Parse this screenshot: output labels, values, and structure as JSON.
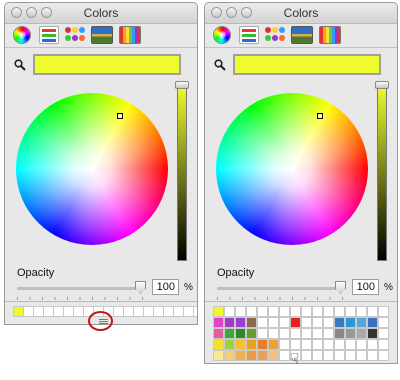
{
  "windows": [
    {
      "title": "Colors",
      "current_color": "#eefc2f",
      "opacity_label": "Opacity",
      "opacity_value": "100",
      "opacity_unit": "%",
      "palette_rows": 1,
      "annotation": "red circle highlighting the drag handle below the swatch row"
    },
    {
      "title": "Colors",
      "current_color": "#eefc2f",
      "opacity_label": "Opacity",
      "opacity_value": "100",
      "opacity_unit": "%",
      "palette_rows": 5,
      "cursor": "hand-cursor"
    }
  ],
  "toolbar_icons": [
    "color-wheel-icon",
    "color-sliders-icon",
    "color-palettes-icon",
    "image-palettes-icon",
    "crayons-icon"
  ],
  "palette_expanded_colors": [
    [
      "#f2f62e",
      "#fff",
      "#fff",
      "#fff",
      "#fff",
      "#fff",
      "#fff",
      "#fff",
      "#fff",
      "#fff",
      "#fff",
      "#fff",
      "#fff",
      "#fff",
      "#fff",
      "#fff"
    ],
    [
      "#e043c8",
      "#a13cc9",
      "#9b3dd0",
      "#8a6a4a",
      "#fff",
      "#fff",
      "#fff",
      "#e82020",
      "#fff",
      "#fff",
      "#fff",
      "#3a78c8",
      "#2a98d8",
      "#53a6e2",
      "#3a6fc0",
      "#fff"
    ],
    [
      "#e85aa0",
      "#3aaa3a",
      "#2a8a2a",
      "#6a9a2a",
      "#fff",
      "#fff",
      "#fff",
      "#fff",
      "#fff",
      "#fff",
      "#fff",
      "#888",
      "#999",
      "#aaa",
      "#333",
      "#fff"
    ],
    [
      "#f2e030",
      "#a0d040",
      "#f2c030",
      "#e8a020",
      "#e08030",
      "#f0a030",
      "#fff",
      "#fff",
      "#fff",
      "#fff",
      "#fff",
      "#fff",
      "#fff",
      "#fff",
      "#fff",
      "#fff"
    ],
    [
      "#f8e898",
      "#f0d070",
      "#f0b050",
      "#ec9a40",
      "#e8a060",
      "#f2c080",
      "#fff",
      "#fff",
      "#fff",
      "#fff",
      "#fff",
      "#fff",
      "#fff",
      "#fff",
      "#fff",
      "#fff"
    ]
  ]
}
